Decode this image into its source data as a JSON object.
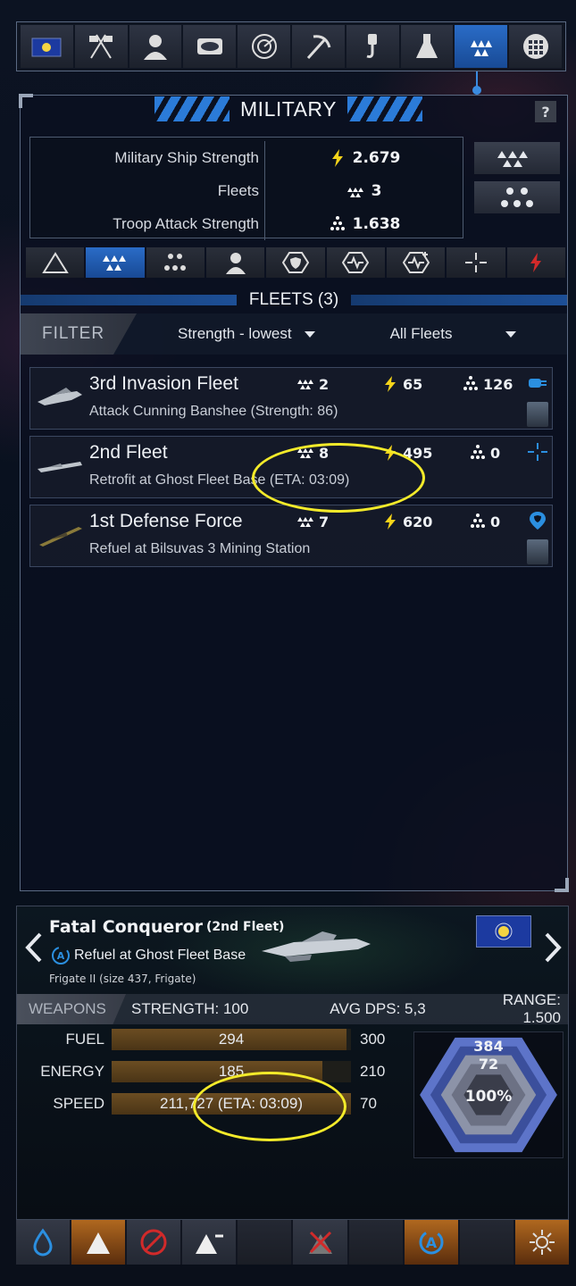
{
  "colors": {
    "accent": "#2a6cc7",
    "lightning": "#f5d41a",
    "orange": "#b0681f",
    "annotation": "#f3ea2a"
  },
  "toolbar": {
    "icons": [
      "empire-flag-icon",
      "diplomacy-flags-icon",
      "characters-icon",
      "planets-icon",
      "radar-icon",
      "mining-pickaxe-icon",
      "construction-hook-icon",
      "research-flask-icon",
      "military-fleets-icon",
      "grid-menu-icon"
    ],
    "active": "military-fleets-icon"
  },
  "panel": {
    "title": "MILITARY",
    "help": "?",
    "stats": [
      {
        "label": "Military Ship Strength",
        "value": "2.679",
        "icon": "lightning-icon"
      },
      {
        "label": "Fleets",
        "value": "3",
        "icon": "fleet-icon"
      },
      {
        "label": "Troop Attack Strength",
        "value": "1.638",
        "icon": "troops-icon"
      }
    ],
    "category_tabs": [
      "triangle-icon",
      "fleets-icon",
      "troops-icon",
      "character-icon",
      "shield-hex-icon",
      "heartbeat-hex-icon",
      "heartbeat-hex-plus-icon",
      "crosshair-icon",
      "lightning-red-icon"
    ]
  },
  "fleets": {
    "header": "FLEETS (3)",
    "filter_label": "FILTER",
    "sort": "Strength - lowest",
    "scope": "All Fleets",
    "rows": [
      {
        "name": "3rd Invasion Fleet",
        "task": "Attack Cunning Banshee (Strength: 86)",
        "ships": "2",
        "strength": "65",
        "troops": "126",
        "status_icon": "fuel-pump-icon",
        "has_avatar": true
      },
      {
        "name": "2nd Fleet",
        "task": "Retrofit at Ghost Fleet Base (ETA: 03:09)",
        "ships": "8",
        "strength": "495",
        "troops": "0",
        "status_icon": "crosshair-icon",
        "has_avatar": false
      },
      {
        "name": "1st Defense Force",
        "task": "Refuel at Bilsuvas 3 Mining Station",
        "ships": "7",
        "strength": "620",
        "troops": "0",
        "status_icon": "location-shield-icon",
        "has_avatar": true
      }
    ]
  },
  "ship": {
    "name": "Fatal Conqueror",
    "fleet": "(2nd Fleet)",
    "task": "Refuel at Ghost Fleet Base",
    "class": "Frigate II (size 437, Frigate)",
    "weapons_label": "WEAPONS",
    "strength": "STRENGTH: 100",
    "dps": "AVG DPS: 5,3",
    "range": "RANGE: 1.500",
    "resources": [
      {
        "label": "FUEL",
        "value": "294",
        "max": "300",
        "fraction": 0.98
      },
      {
        "label": "ENERGY",
        "value": "185",
        "max": "210",
        "fraction": 0.88
      },
      {
        "label": "SPEED",
        "value": "211,727 (ETA: 03:09)",
        "max": "70",
        "fraction": 1.0
      }
    ],
    "hp": {
      "structure": "384",
      "armor": "72",
      "shield": "100%"
    }
  },
  "actions": [
    "refuel-drop-icon",
    "up-arrow-icon",
    "cancel-icon",
    "triangle-minus-icon",
    "empty-slot",
    "disband-x-icon",
    "empty-slot",
    "automate-icon",
    "empty-slot",
    "formation-gear-icon"
  ]
}
